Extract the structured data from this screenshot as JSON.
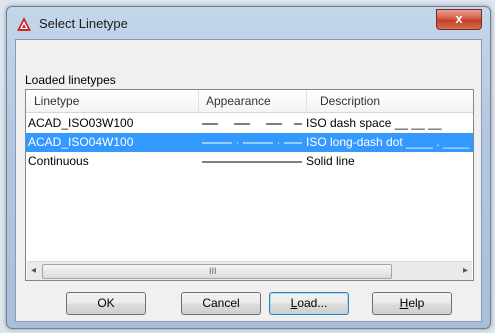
{
  "window": {
    "title": "Select Linetype",
    "close_glyph": "x"
  },
  "group": {
    "label": "Loaded linetypes"
  },
  "table": {
    "columns": [
      "Linetype",
      "Appearance",
      "Description"
    ],
    "rows": [
      {
        "name": "ACAD_ISO03W100",
        "description": "ISO dash space __  __  __",
        "appearance": "dash-space",
        "selected": false
      },
      {
        "name": "ACAD_ISO04W100",
        "description": "ISO long-dash dot ____ . ____",
        "appearance": "long-dash-dot",
        "selected": true
      },
      {
        "name": "Continuous",
        "description": "Solid line",
        "appearance": "solid",
        "selected": false
      }
    ]
  },
  "scrollbar": {
    "left_arrow": "◂",
    "right_arrow": "▸",
    "grip": "III"
  },
  "buttons": {
    "ok": "OK",
    "cancel": "Cancel",
    "load_prefix": "",
    "load_mnemonic": "L",
    "load_rest": "oad...",
    "help_prefix": "",
    "help_mnemonic": "H",
    "help_rest": "elp"
  },
  "colors": {
    "selection": "#3399ff",
    "accent_close": "#c0402a"
  },
  "icons": {
    "app": "autocad-app-icon",
    "close": "close-icon"
  }
}
